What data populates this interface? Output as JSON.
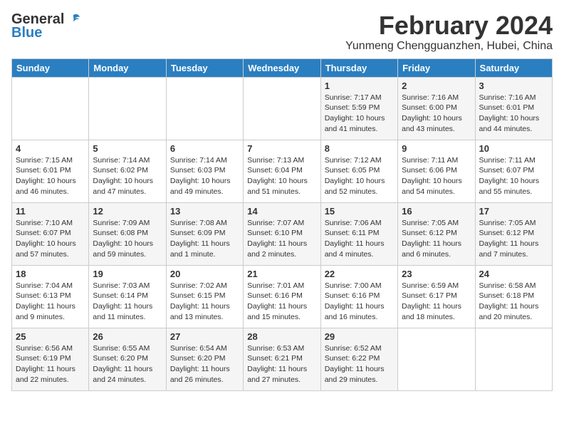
{
  "header": {
    "logo_general": "General",
    "logo_blue": "Blue",
    "month_title": "February 2024",
    "location": "Yunmeng Chengguanzhen, Hubei, China"
  },
  "days_of_week": [
    "Sunday",
    "Monday",
    "Tuesday",
    "Wednesday",
    "Thursday",
    "Friday",
    "Saturday"
  ],
  "weeks": [
    [
      {
        "day": "",
        "info": ""
      },
      {
        "day": "",
        "info": ""
      },
      {
        "day": "",
        "info": ""
      },
      {
        "day": "",
        "info": ""
      },
      {
        "day": "1",
        "info": "Sunrise: 7:17 AM\nSunset: 5:59 PM\nDaylight: 10 hours\nand 41 minutes."
      },
      {
        "day": "2",
        "info": "Sunrise: 7:16 AM\nSunset: 6:00 PM\nDaylight: 10 hours\nand 43 minutes."
      },
      {
        "day": "3",
        "info": "Sunrise: 7:16 AM\nSunset: 6:01 PM\nDaylight: 10 hours\nand 44 minutes."
      }
    ],
    [
      {
        "day": "4",
        "info": "Sunrise: 7:15 AM\nSunset: 6:01 PM\nDaylight: 10 hours\nand 46 minutes."
      },
      {
        "day": "5",
        "info": "Sunrise: 7:14 AM\nSunset: 6:02 PM\nDaylight: 10 hours\nand 47 minutes."
      },
      {
        "day": "6",
        "info": "Sunrise: 7:14 AM\nSunset: 6:03 PM\nDaylight: 10 hours\nand 49 minutes."
      },
      {
        "day": "7",
        "info": "Sunrise: 7:13 AM\nSunset: 6:04 PM\nDaylight: 10 hours\nand 51 minutes."
      },
      {
        "day": "8",
        "info": "Sunrise: 7:12 AM\nSunset: 6:05 PM\nDaylight: 10 hours\nand 52 minutes."
      },
      {
        "day": "9",
        "info": "Sunrise: 7:11 AM\nSunset: 6:06 PM\nDaylight: 10 hours\nand 54 minutes."
      },
      {
        "day": "10",
        "info": "Sunrise: 7:11 AM\nSunset: 6:07 PM\nDaylight: 10 hours\nand 55 minutes."
      }
    ],
    [
      {
        "day": "11",
        "info": "Sunrise: 7:10 AM\nSunset: 6:07 PM\nDaylight: 10 hours\nand 57 minutes."
      },
      {
        "day": "12",
        "info": "Sunrise: 7:09 AM\nSunset: 6:08 PM\nDaylight: 10 hours\nand 59 minutes."
      },
      {
        "day": "13",
        "info": "Sunrise: 7:08 AM\nSunset: 6:09 PM\nDaylight: 11 hours\nand 1 minute."
      },
      {
        "day": "14",
        "info": "Sunrise: 7:07 AM\nSunset: 6:10 PM\nDaylight: 11 hours\nand 2 minutes."
      },
      {
        "day": "15",
        "info": "Sunrise: 7:06 AM\nSunset: 6:11 PM\nDaylight: 11 hours\nand 4 minutes."
      },
      {
        "day": "16",
        "info": "Sunrise: 7:05 AM\nSunset: 6:12 PM\nDaylight: 11 hours\nand 6 minutes."
      },
      {
        "day": "17",
        "info": "Sunrise: 7:05 AM\nSunset: 6:12 PM\nDaylight: 11 hours\nand 7 minutes."
      }
    ],
    [
      {
        "day": "18",
        "info": "Sunrise: 7:04 AM\nSunset: 6:13 PM\nDaylight: 11 hours\nand 9 minutes."
      },
      {
        "day": "19",
        "info": "Sunrise: 7:03 AM\nSunset: 6:14 PM\nDaylight: 11 hours\nand 11 minutes."
      },
      {
        "day": "20",
        "info": "Sunrise: 7:02 AM\nSunset: 6:15 PM\nDaylight: 11 hours\nand 13 minutes."
      },
      {
        "day": "21",
        "info": "Sunrise: 7:01 AM\nSunset: 6:16 PM\nDaylight: 11 hours\nand 15 minutes."
      },
      {
        "day": "22",
        "info": "Sunrise: 7:00 AM\nSunset: 6:16 PM\nDaylight: 11 hours\nand 16 minutes."
      },
      {
        "day": "23",
        "info": "Sunrise: 6:59 AM\nSunset: 6:17 PM\nDaylight: 11 hours\nand 18 minutes."
      },
      {
        "day": "24",
        "info": "Sunrise: 6:58 AM\nSunset: 6:18 PM\nDaylight: 11 hours\nand 20 minutes."
      }
    ],
    [
      {
        "day": "25",
        "info": "Sunrise: 6:56 AM\nSunset: 6:19 PM\nDaylight: 11 hours\nand 22 minutes."
      },
      {
        "day": "26",
        "info": "Sunrise: 6:55 AM\nSunset: 6:20 PM\nDaylight: 11 hours\nand 24 minutes."
      },
      {
        "day": "27",
        "info": "Sunrise: 6:54 AM\nSunset: 6:20 PM\nDaylight: 11 hours\nand 26 minutes."
      },
      {
        "day": "28",
        "info": "Sunrise: 6:53 AM\nSunset: 6:21 PM\nDaylight: 11 hours\nand 27 minutes."
      },
      {
        "day": "29",
        "info": "Sunrise: 6:52 AM\nSunset: 6:22 PM\nDaylight: 11 hours\nand 29 minutes."
      },
      {
        "day": "",
        "info": ""
      },
      {
        "day": "",
        "info": ""
      }
    ]
  ]
}
